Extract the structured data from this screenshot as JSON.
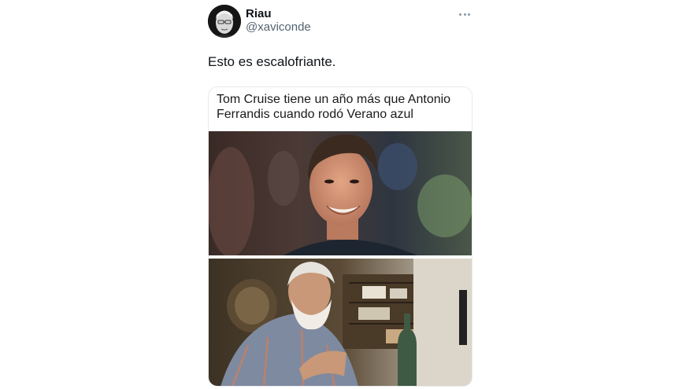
{
  "author": {
    "display_name": "Riau",
    "handle": "@xaviconde"
  },
  "tweet": {
    "text": "Esto es escalofriante."
  },
  "media": {
    "meme_caption": "Tom Cruise tiene un año más que Antonio\nFerrandis cuando rodó  Verano azul"
  },
  "icons": {
    "more": "more-horizontal-icon"
  },
  "colors": {
    "text_primary": "#0f1419",
    "text_secondary": "#536471",
    "icon_gray": "#8899a6"
  }
}
